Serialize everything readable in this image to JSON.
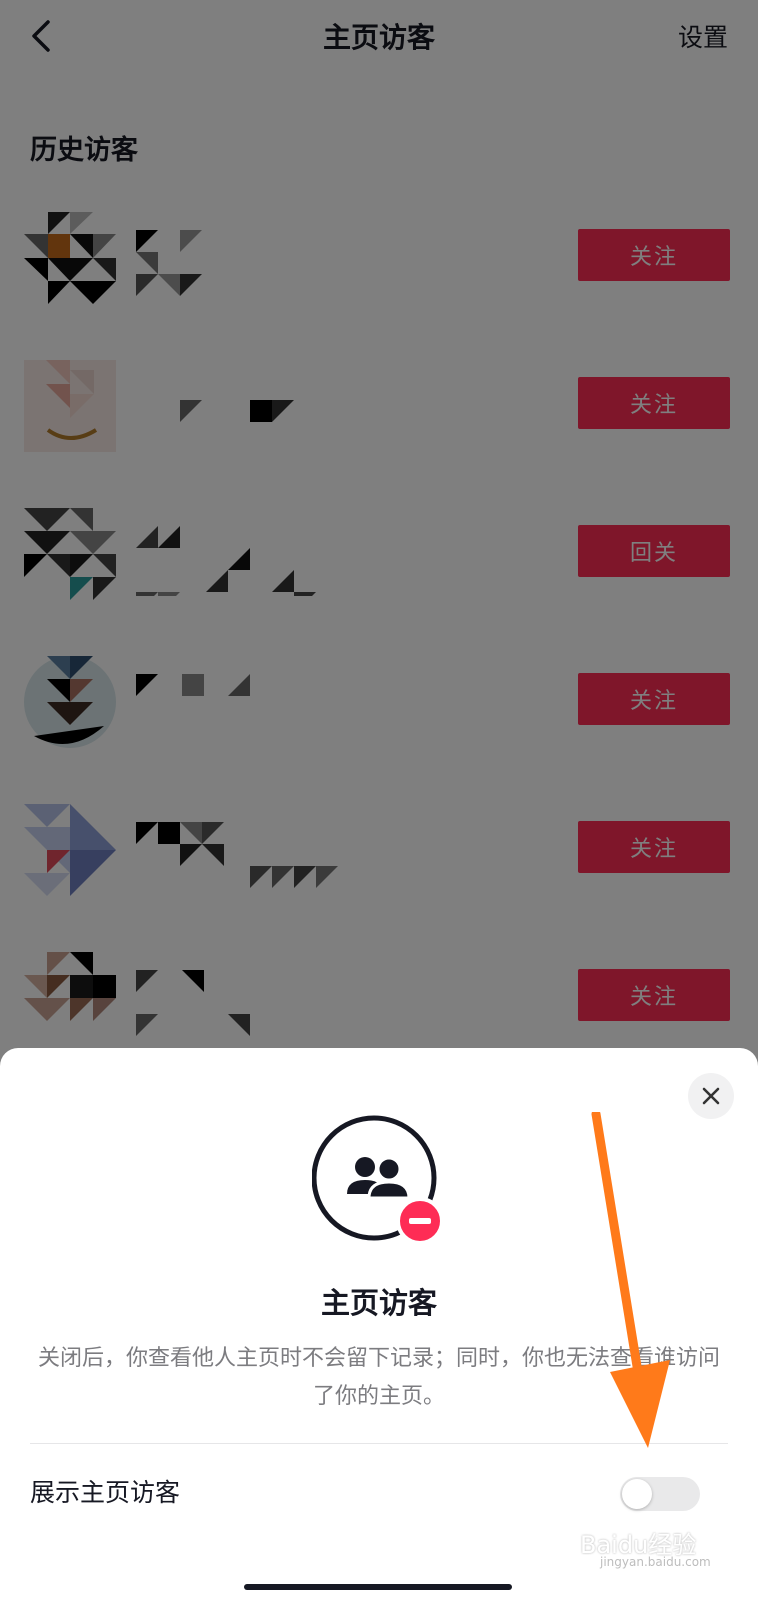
{
  "nav": {
    "title": "主页访客",
    "settings": "设置"
  },
  "section_title": "历史访客",
  "visitors": [
    {
      "button": "关注"
    },
    {
      "button": "关注"
    },
    {
      "button": "回关"
    },
    {
      "button": "关注"
    },
    {
      "button": "关注"
    },
    {
      "button": "关注"
    }
  ],
  "sheet": {
    "title": "主页访客",
    "description": "关闭后，你查看他人主页时不会留下记录；同时，你也无法查看谁访问了你的主页。",
    "toggle_label": "展示主页访客",
    "toggle_on": false
  },
  "watermark": {
    "text": "Baidu经验",
    "sub": "jingyan.baidu.com"
  },
  "colors": {
    "accent": "#fe2c55",
    "arrow": "#ff7a1a"
  }
}
